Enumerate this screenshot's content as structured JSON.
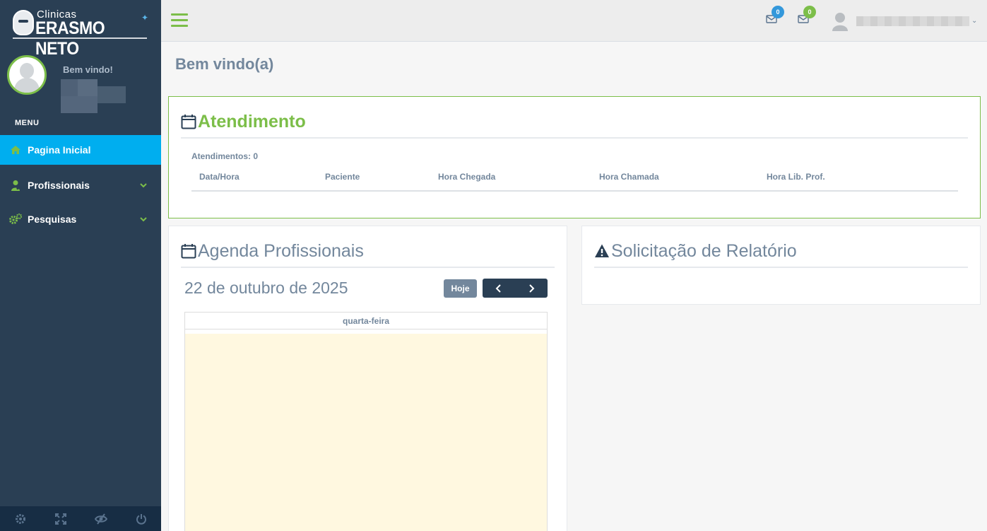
{
  "brand": {
    "small": "Clinicas",
    "big": "ERASMO NETO"
  },
  "sidebar": {
    "welcome": "Bem vindo!",
    "menu_title": "MENU",
    "items": [
      {
        "label": "Pagina Inicial",
        "icon": "home-icon",
        "active": true
      },
      {
        "label": "Profissionais",
        "icon": "user-md-icon"
      },
      {
        "label": "Pesquisas",
        "icon": "cogs-icon"
      }
    ],
    "footer_icons": [
      "settings-icon",
      "fullscreen-icon",
      "eye-slash-icon",
      "power-icon"
    ]
  },
  "topnav": {
    "mail_badges": [
      {
        "count": "0",
        "color": "#3498db"
      },
      {
        "count": "0",
        "color": "#7cbe49"
      }
    ]
  },
  "page": {
    "title": "Bem vindo(a)"
  },
  "atendimento": {
    "title": "Atendimento",
    "count_label": "Atendimentos: 0",
    "columns": [
      "Data/Hora",
      "Paciente",
      "Hora Chegada",
      "Hora Chamada",
      "Hora Lib. Prof."
    ]
  },
  "agenda": {
    "title": "Agenda Profissionais",
    "date": "22 de outubro de 2025",
    "today_btn": "Hoje",
    "day_header": "quarta-feira"
  },
  "relatorio": {
    "title": "Solicitação de Relatório"
  },
  "colors": {
    "accent": "#7cbe49",
    "sidebar": "#2a3f54",
    "active": "#00aeef",
    "text": "#73879c"
  }
}
